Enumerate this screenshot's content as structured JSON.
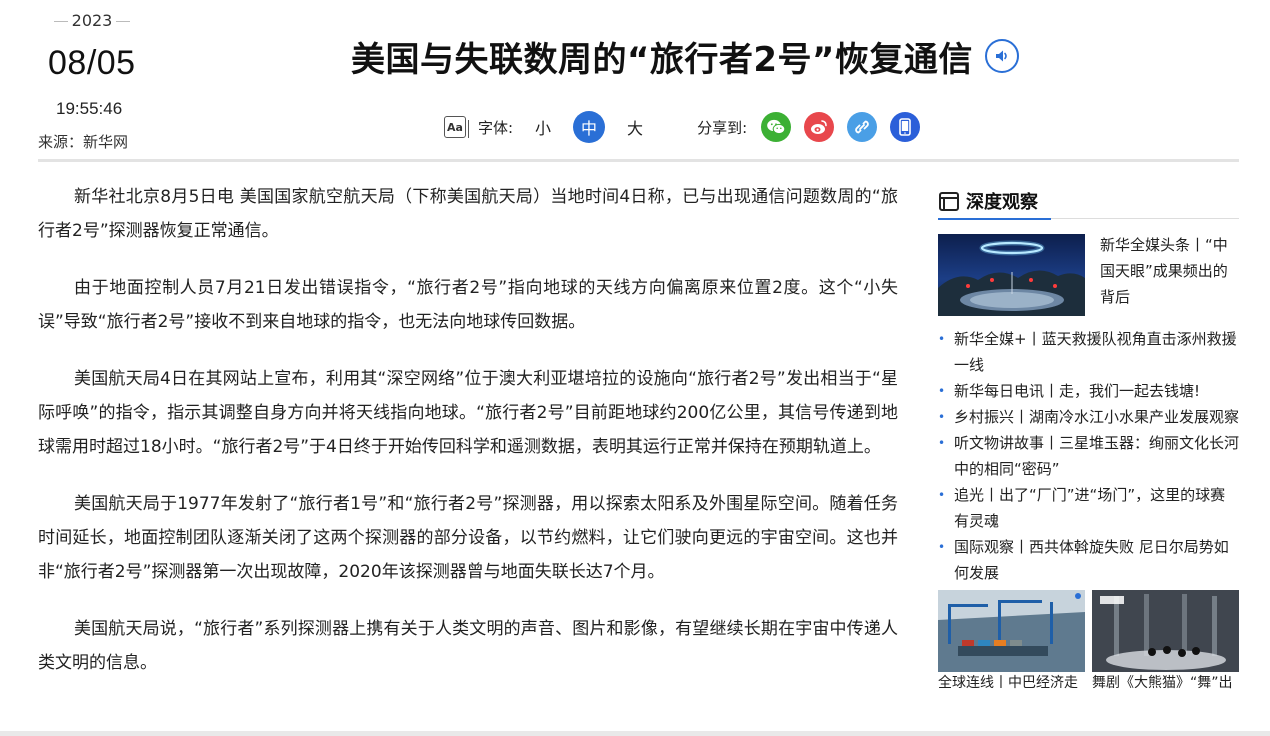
{
  "date": {
    "year": "2023",
    "day": "08/05",
    "time": "19:55:46",
    "source": "来源：新华网"
  },
  "headline": "美国与失联数周的“旅行者2号”恢复通信",
  "toolbar": {
    "font_label": "字体:",
    "sizes": [
      "小",
      "中",
      "大"
    ],
    "active_size": "中",
    "share_label": "分享到:",
    "share_icons": [
      "wechat-icon",
      "weibo-icon",
      "link-icon",
      "mobile-icon"
    ]
  },
  "colors": {
    "accent": "#2a6fd6",
    "wechat": "#3cb034",
    "weibo": "#e8474c",
    "link": "#4a9fe6",
    "mobile": "#2b5fd9"
  },
  "article": {
    "paragraphs": [
      "新华社北京8月5日电 美国国家航空航天局（下称美国航天局）当地时间4日称，已与出现通信问题数周的“旅行者2号”探测器恢复正常通信。",
      "由于地面控制人员7月21日发出错误指令，“旅行者2号”指向地球的天线方向偏离原来位置2度。这个“小失误”导致“旅行者2号”接收不到来自地球的指令，也无法向地球传回数据。",
      "美国航天局4日在其网站上宣布，利用其“深空网络”位于澳大利亚堪培拉的设施向“旅行者2号”发出相当于“星际呼唤”的指令，指示其调整自身方向并将天线指向地球。“旅行者2号”目前距地球约200亿公里，其信号传递到地球需用时超过18小时。“旅行者2号”于4日终于开始传回科学和遥测数据，表明其运行正常并保持在预期轨道上。",
      "美国航天局于1977年发射了“旅行者1号”和“旅行者2号”探测器，用以探索太阳系及外围星际空间。随着任务时间延长，地面控制团队逐渐关闭了这两个探测器的部分设备，以节约燃料，让它们驶向更远的宇宙空间。这也并非“旅行者2号”探测器第一次出现故障，2020年该探测器曾与地面失联长达7个月。",
      "美国航天局说，“旅行者”系列探测器上携有关于人类文明的声音、图片和影像，有望继续长期在宇宙中传递人类文明的信息。"
    ]
  },
  "sidebar": {
    "title": "深度观察",
    "feature": {
      "text": "新华全媒头条丨“中国天眼”成果频出的背后"
    },
    "list": [
      "新华全媒+丨蓝天救援队视角直击涿州救援一线",
      "新华每日电讯丨走，我们一起去钱塘!",
      "乡村振兴丨湖南冷水江小水果产业发展观察",
      "听文物讲故事丨三星堆玉器：绚丽文化长河中的相同“密码”",
      "追光丨出了“厂门”进“场门”，这里的球赛有灵魂",
      "国际观察丨西共体斡旋失败 尼日尔局势如何发展"
    ],
    "thumbs": [
      {
        "caption": "全球连线丨中巴经济走"
      },
      {
        "caption": "舞剧《大熊猫》“舞”出"
      }
    ]
  }
}
